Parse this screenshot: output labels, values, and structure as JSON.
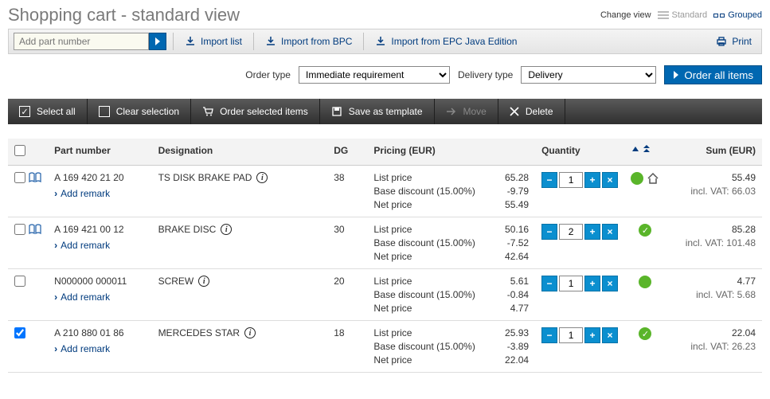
{
  "header": {
    "title": "Shopping cart - standard view",
    "change_view_label": "Change view",
    "standard_label": "Standard",
    "grouped_label": "Grouped"
  },
  "toolbar": {
    "add_part_placeholder": "Add part number",
    "import_list": "Import list",
    "import_bpc": "Import from BPC",
    "import_epc": "Import from EPC Java Edition",
    "print": "Print"
  },
  "order_bar": {
    "order_type_label": "Order type",
    "order_type_value": "Immediate requirement",
    "delivery_type_label": "Delivery type",
    "delivery_type_value": "Delivery",
    "order_all_label": "Order all items"
  },
  "action_bar": {
    "select_all": "Select all",
    "clear_selection": "Clear selection",
    "order_selected": "Order selected items",
    "save_template": "Save as template",
    "move": "Move",
    "delete": "Delete"
  },
  "table": {
    "headers": {
      "part_number": "Part number",
      "designation": "Designation",
      "dg": "DG",
      "pricing": "Pricing (EUR)",
      "quantity": "Quantity",
      "sum": "Sum (EUR)"
    },
    "price_labels": {
      "list": "List price",
      "base_discount": "Base discount (15.00%)",
      "net": "Net price"
    },
    "add_remark_label": "Add remark",
    "vat_prefix": "incl. VAT: ",
    "rows": [
      {
        "checked": false,
        "book_icon": true,
        "part_number": "A 169 420 21 20",
        "designation": "TS DISK BRAKE PAD",
        "dg": "38",
        "list_price": "65.28",
        "discount": "-9.79",
        "net_price": "55.49",
        "qty": "1",
        "status": "dot-house",
        "sum": "55.49",
        "vat": "66.03"
      },
      {
        "checked": false,
        "book_icon": true,
        "part_number": "A 169 421 00 12",
        "designation": "BRAKE DISC",
        "dg": "30",
        "list_price": "50.16",
        "discount": "-7.52",
        "net_price": "42.64",
        "qty": "2",
        "status": "check",
        "sum": "85.28",
        "vat": "101.48"
      },
      {
        "checked": false,
        "book_icon": false,
        "part_number": "N000000 000011",
        "designation": "SCREW",
        "dg": "20",
        "list_price": "5.61",
        "discount": "-0.84",
        "net_price": "4.77",
        "qty": "1",
        "status": "dot",
        "sum": "4.77",
        "vat": "5.68"
      },
      {
        "checked": true,
        "book_icon": false,
        "part_number": "A 210 880 01 86",
        "designation": "MERCEDES STAR",
        "dg": "18",
        "list_price": "25.93",
        "discount": "-3.89",
        "net_price": "22.04",
        "qty": "1",
        "status": "check",
        "sum": "22.04",
        "vat": "26.23"
      }
    ]
  }
}
